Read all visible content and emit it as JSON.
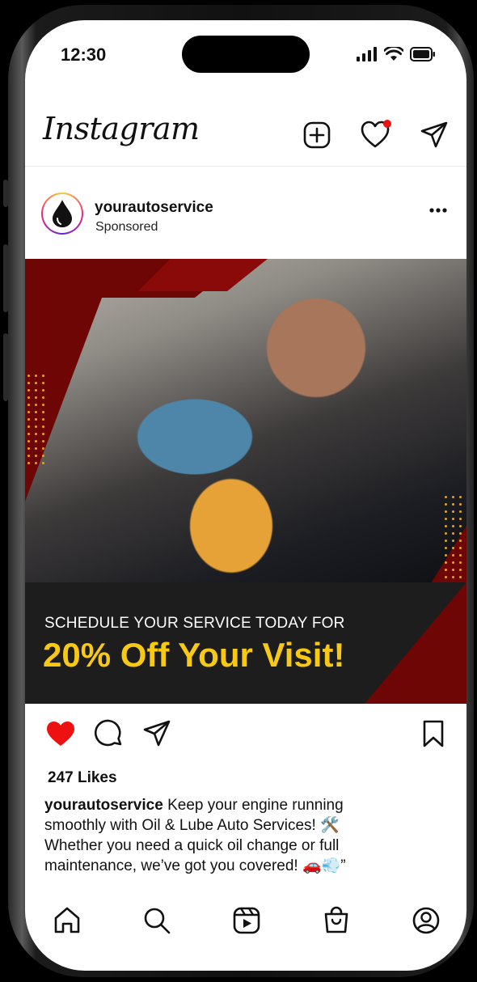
{
  "status": {
    "time": "12:30"
  },
  "header": {
    "logo": "Instagram"
  },
  "post": {
    "username": "yourautoservice",
    "subtitle": "Sponsored",
    "ad": {
      "subheadline": "SCHEDULE YOUR SERVICE TODAY FOR",
      "headline": "20% Off Your Visit!"
    },
    "likes": "247 Likes",
    "caption_user": "yourautoservice",
    "caption_text": " Keep your engine running smoothly with Oil & Lube Auto Services! 🛠️ Whether you need a quick oil change or full maintenance, we’ve got you covered! 🚗💨”",
    "liked": true
  },
  "colors": {
    "like_red": "#ee1111",
    "ad_red": "#6e0606",
    "ad_yellow": "#f7c914",
    "notification_dot": "#ee1111"
  },
  "icons": {
    "header": [
      "new-post-icon",
      "heart-icon",
      "direct-message-icon"
    ],
    "actions": [
      "heart-filled-icon",
      "comment-icon",
      "share-icon",
      "bookmark-icon"
    ],
    "nav": [
      "home-icon",
      "search-icon",
      "reels-icon",
      "shop-icon",
      "profile-icon"
    ]
  }
}
